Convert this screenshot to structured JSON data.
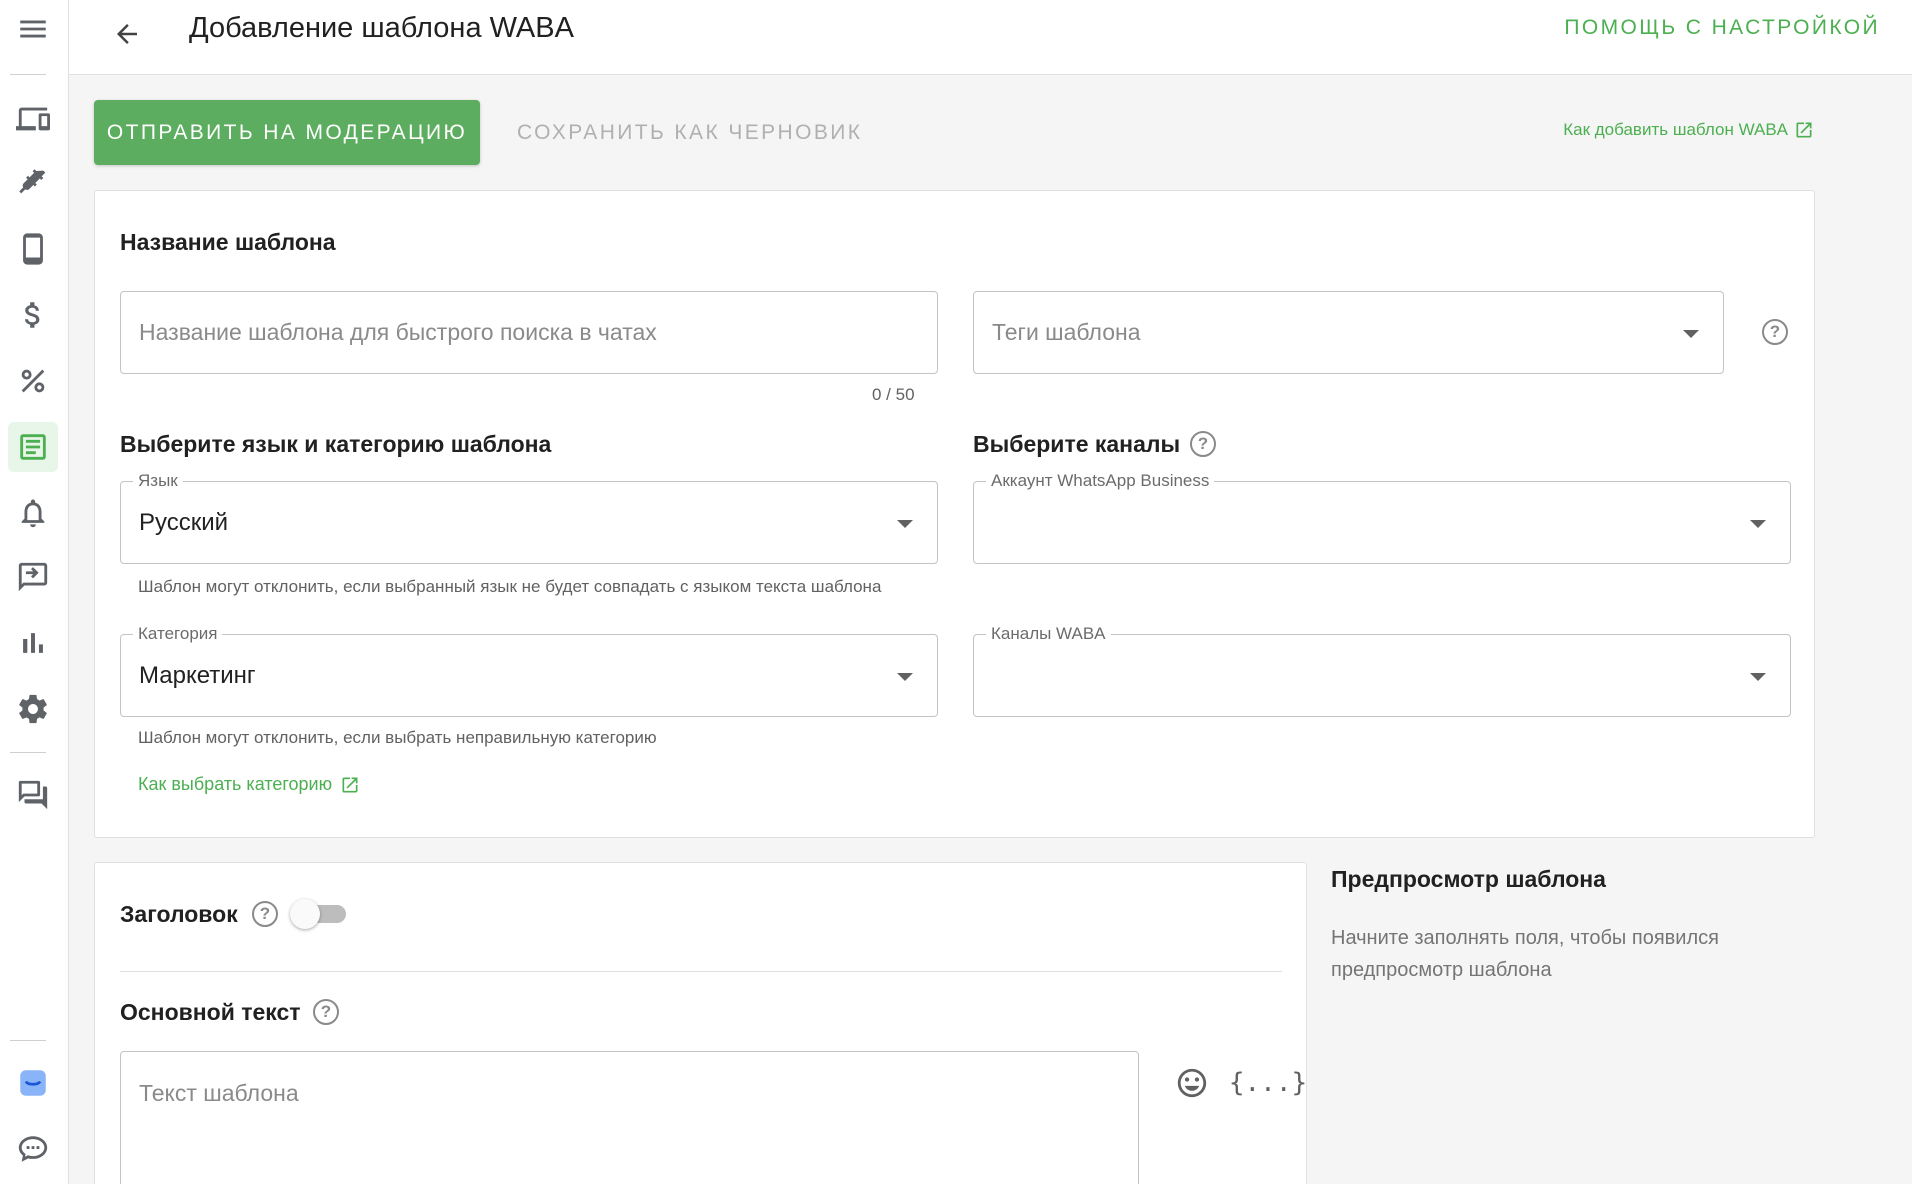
{
  "header": {
    "title": "Добавление шаблона WABA",
    "help_link": "ПОМОЩЬ С НАСТРОЙКОЙ"
  },
  "sidebar": {
    "items": [
      {
        "icon": "menu-icon"
      },
      {
        "icon": "devices-icon"
      },
      {
        "icon": "plug-icon"
      },
      {
        "icon": "phone-icon"
      },
      {
        "icon": "dollar-icon"
      },
      {
        "icon": "percent-icon"
      },
      {
        "icon": "template-icon",
        "active": true
      },
      {
        "icon": "bell-icon"
      },
      {
        "icon": "message-forward-icon"
      },
      {
        "icon": "bar-chart-icon"
      },
      {
        "icon": "gear-icon"
      },
      {
        "icon": "forum-icon"
      },
      {
        "icon": "brand-logo-icon"
      },
      {
        "icon": "chat-bubble-icon"
      }
    ],
    "accent_color": "#4caf50"
  },
  "actions": {
    "submit_label": "ОТПРАВИТЬ НА МОДЕРАЦИЮ",
    "draft_label": "СОХРАНИТЬ КАК ЧЕРНОВИК",
    "doc_link": "Как добавить шаблон WABA"
  },
  "template_form": {
    "name_section_title": "Название шаблона",
    "name_placeholder": "Название шаблона для быстрого поиска в чатах",
    "name_counter": "0 / 50",
    "tags_placeholder": "Теги шаблона",
    "lang_section_title": "Выберите язык и категорию шаблона",
    "language": {
      "label": "Язык",
      "value": "Русский",
      "hint": "Шаблон могут отклонить, если выбранный язык не будет совпадать с языком текста шаблона"
    },
    "category": {
      "label": "Категория",
      "value": "Маркетинг",
      "hint": "Шаблон могут отклонить, если выбрать неправильную категорию",
      "link": "Как выбрать категорию"
    },
    "channels_section_title": "Выберите каналы",
    "wa_account": {
      "label": "Аккаунт WhatsApp Business",
      "value": ""
    },
    "waba_channels": {
      "label": "Каналы WABA",
      "value": ""
    }
  },
  "content": {
    "header_label": "Заголовок",
    "header_enabled": false,
    "body_label": "Основной текст",
    "body_placeholder": "Текст шаблона",
    "variable_icon_text": "{...}"
  },
  "preview": {
    "title": "Предпросмотр шаблона",
    "empty_text": "Начните заполнять поля, чтобы появился предпросмотр шаблона"
  }
}
